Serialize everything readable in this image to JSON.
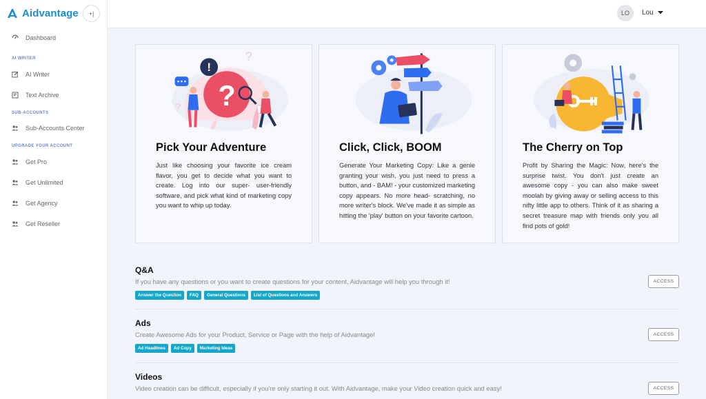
{
  "app": {
    "name": "Aidvantage",
    "collapse_label": "+|"
  },
  "colors": {
    "brand": "#1b8fd1",
    "tag": "#17a6c9",
    "section_label": "#6d83c9"
  },
  "sidebar": {
    "dashboard": {
      "label": "Dashboard",
      "icon": "dashboard-icon"
    },
    "sections": [
      {
        "title": "AI WRITER",
        "items": [
          {
            "label": "AI Writer",
            "icon": "edit-icon"
          },
          {
            "label": "Text Archive",
            "icon": "archive-icon"
          }
        ]
      },
      {
        "title": "SUB-ACCOUNTS",
        "items": [
          {
            "label": "Sub-Accounts Center",
            "icon": "users-icon"
          }
        ]
      },
      {
        "title": "UPGRADE YOUR ACCOUNT",
        "items": [
          {
            "label": "Get Pro",
            "icon": "users-icon"
          },
          {
            "label": "Get Unlimited",
            "icon": "users-icon"
          },
          {
            "label": "Get Agency",
            "icon": "users-icon"
          },
          {
            "label": "Get Reseller",
            "icon": "users-icon"
          }
        ]
      }
    ]
  },
  "user": {
    "initials": "LO",
    "name": "Lou"
  },
  "cards": [
    {
      "title": "Pick Your Adventure",
      "text": "Just like choosing your favorite ice cream flavor, you get to decide what you want to create. Log into our super- user-friendly software, and pick what kind of marketing copy you want to whip up today."
    },
    {
      "title": "Click, Click, BOOM",
      "text": "Generate Your Marketing Copy: Like a genie granting your wish, you just need to press a button, and - BAM! - your customized marketing copy appears. No more head- scratching, no more writer's block. We've made it as simple as hitting the 'play' button on your favorite cartoon."
    },
    {
      "title": "The Cherry on Top",
      "text": "Profit by Sharing the Magic: Now, here's the surprise twist. You don't just create an awesome copy - you can also make sweet moolah by giving away or selling access to this nifty little app to others. Think of it as sharing a secret treasure map with friends only you all find pots of gold!"
    }
  ],
  "sections": [
    {
      "title": "Q&A",
      "desc": "If you have any questions or you want to create questions for your content, Aidvantage will help you through it!",
      "tags": [
        "Answer the Question",
        "FAQ",
        "General Questions",
        "List of Questions and Answers"
      ],
      "button": "ACCESS"
    },
    {
      "title": "Ads",
      "desc": "Create Awesome Ads for your Product, Service or Page with the help of Aidvantage!",
      "tags": [
        "Ad Headlines",
        "Ad Copy",
        "Marketing Ideas"
      ],
      "button": "ACCESS"
    },
    {
      "title": "Videos",
      "desc": "Video creation can be difficult, especially if you're only starting it out. With Aidvantage, make your Video creation quick and easy!",
      "tags": [],
      "button": "ACCESS"
    }
  ]
}
